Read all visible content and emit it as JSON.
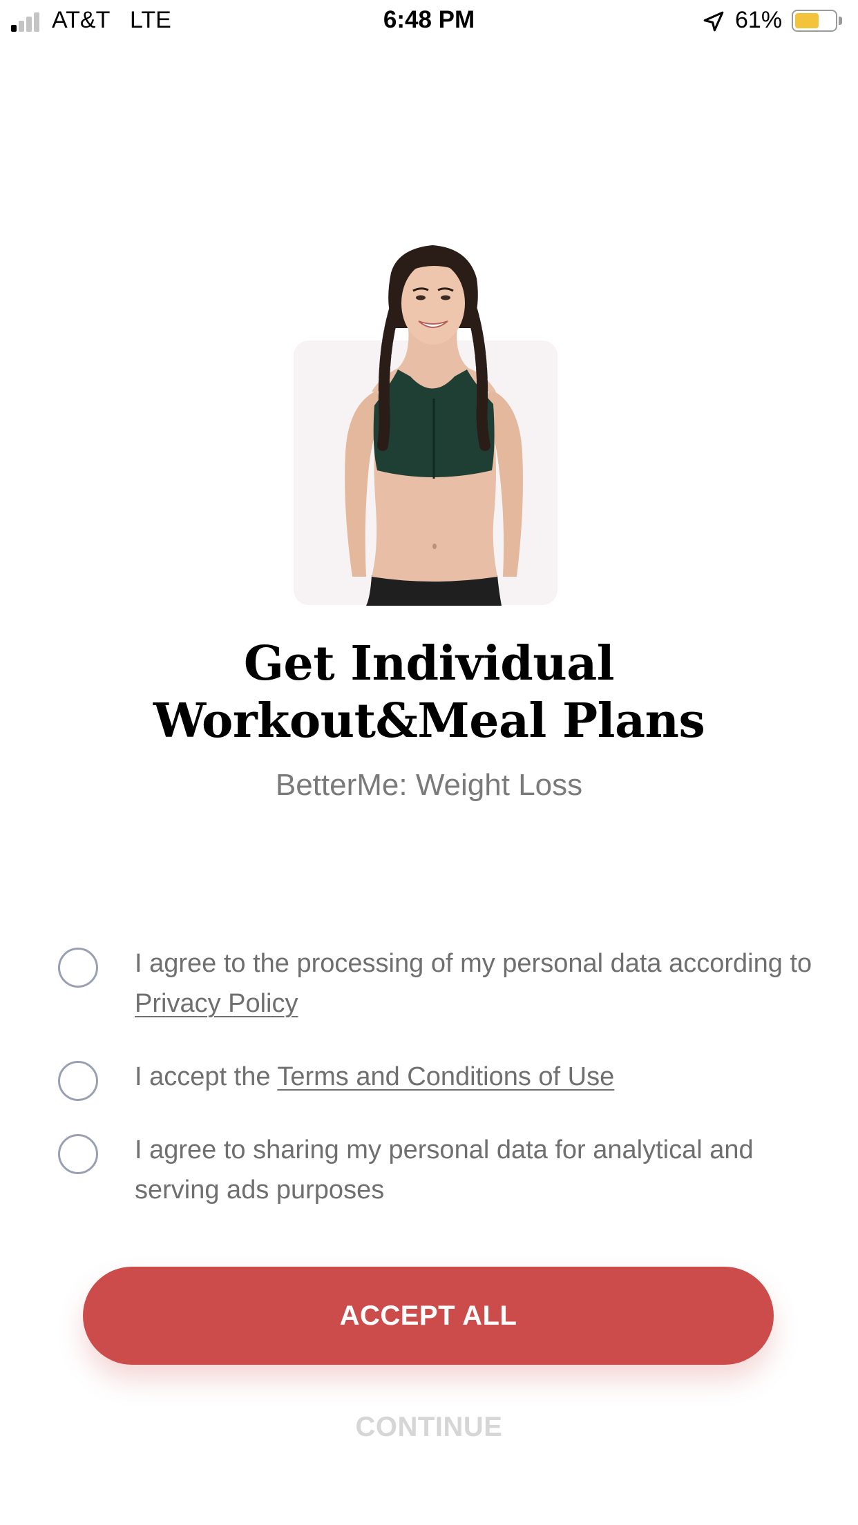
{
  "status_bar": {
    "carrier": "AT&T",
    "network": "LTE",
    "time": "6:48 PM",
    "battery_percent": "61%",
    "battery_level": 0.61,
    "battery_color": "#f3c33b",
    "signal_bars_active": 1,
    "signal_bars_total": 4,
    "icons": [
      "signal-icon",
      "location-arrow-icon",
      "battery-icon"
    ]
  },
  "hero": {
    "image_subject": "woman-in-sports-bra"
  },
  "title": {
    "line1": "Get Individual",
    "line2": "Workout&Meal Plans"
  },
  "subtitle": "BetterMe: Weight Loss",
  "consents": [
    {
      "checked": false,
      "text_before": "I agree to the processing of my personal data according to ",
      "link": "Privacy Policy",
      "text_after": ""
    },
    {
      "checked": false,
      "text_before": "I accept the ",
      "link": "Terms and Conditions of Use",
      "text_after": ""
    },
    {
      "checked": false,
      "text_before": "I agree to sharing my personal data for analytical and serving ads purposes",
      "link": "",
      "text_after": ""
    }
  ],
  "buttons": {
    "accept_all": "ACCEPT ALL",
    "continue": "CONTINUE"
  },
  "colors": {
    "accent": "#cc4c4b",
    "subtitle": "#7a7a7a",
    "consent_text": "#6f6f6f",
    "radio_border": "#9aa0b4",
    "disabled": "#d6d6d6"
  }
}
